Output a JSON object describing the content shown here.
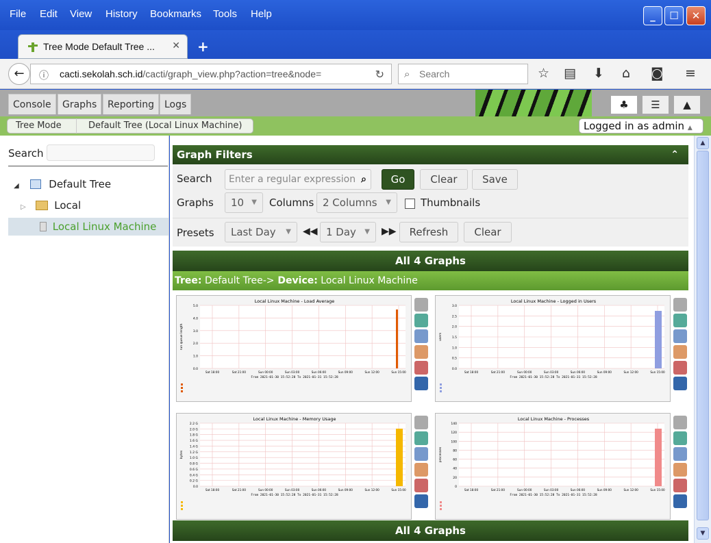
{
  "browser": {
    "menu": [
      "File",
      "Edit",
      "View",
      "History",
      "Bookmarks",
      "Tools",
      "Help"
    ],
    "tab_title": "Tree Mode Default Tree ...",
    "url_domain": "cacti.sekolah.sch.id",
    "url_rest": "/cacti/graph_view.php?action=tree&node=",
    "search_placeholder": "Search"
  },
  "cacti": {
    "tabs": [
      "Console",
      "Graphs",
      "Reporting",
      "Logs"
    ],
    "active_tab": "Graphs",
    "breadcrumb": [
      "Tree Mode",
      "Default Tree (Local Linux Machine)"
    ],
    "logged_in": "Logged in as admin"
  },
  "sidebar": {
    "search_label": "Search",
    "tree": [
      {
        "label": "Default Tree",
        "level": 0
      },
      {
        "label": "Local",
        "level": 1
      },
      {
        "label": "Local Linux Machine",
        "level": 2,
        "selected": true
      }
    ]
  },
  "filters": {
    "header": "Graph Filters",
    "search_label": "Search",
    "search_placeholder": "Enter a regular expression",
    "go": "Go",
    "clear": "Clear",
    "save": "Save",
    "graphs_label": "Graphs",
    "graphs_value": "10",
    "columns_label": "Columns",
    "columns_value": "2 Columns",
    "thumbnails": "Thumbnails",
    "presets_label": "Presets",
    "preset_value": "Last Day",
    "span_value": "1 Day",
    "refresh": "Refresh",
    "clear2": "Clear"
  },
  "content": {
    "all_graphs": "All 4 Graphs",
    "tree_prefix": "Tree:",
    "tree_name": " Default Tree->",
    "device_prefix": " Device:",
    "device_name": " Local Linux Machine"
  },
  "graphs": [
    {
      "title": "Local Linux Machine - Load Average",
      "ylabel": "run queue length",
      "yticks": [
        "5.0",
        "4.0",
        "3.0",
        "2.0",
        "1.0",
        "0.0"
      ],
      "color": "#e05a00"
    },
    {
      "title": "Local Linux Machine - Logged in Users",
      "ylabel": "users",
      "yticks": [
        "3.0",
        "2.5",
        "2.0",
        "1.5",
        "1.0",
        "0.5",
        "0.0"
      ],
      "color": "#8f9ee0"
    },
    {
      "title": "Local Linux Machine - Memory Usage",
      "ylabel": "bytes",
      "yticks": [
        "2.2 G",
        "2.0 G",
        "1.8 G",
        "1.6 G",
        "1.4 G",
        "1.2 G",
        "1.0 G",
        "0.8 G",
        "0.6 G",
        "0.4 G",
        "0.2 G",
        "0.0"
      ],
      "color": "#f5b800"
    },
    {
      "title": "Local Linux Machine - Processes",
      "ylabel": "processes",
      "yticks": [
        "140",
        "120",
        "100",
        "80",
        "60",
        "40",
        "20",
        "0"
      ],
      "color": "#f08a8a"
    }
  ],
  "xticks": [
    "Sat 18:00",
    "Sat 21:00",
    "Sun 00:00",
    "Sun 03:00",
    "Sun 06:00",
    "Sun 09:00",
    "Sun 12:00",
    "Sun 15:00"
  ],
  "from_to": "From 2021-01-30 15:52:28 To 2021-01-31 15:52:28"
}
